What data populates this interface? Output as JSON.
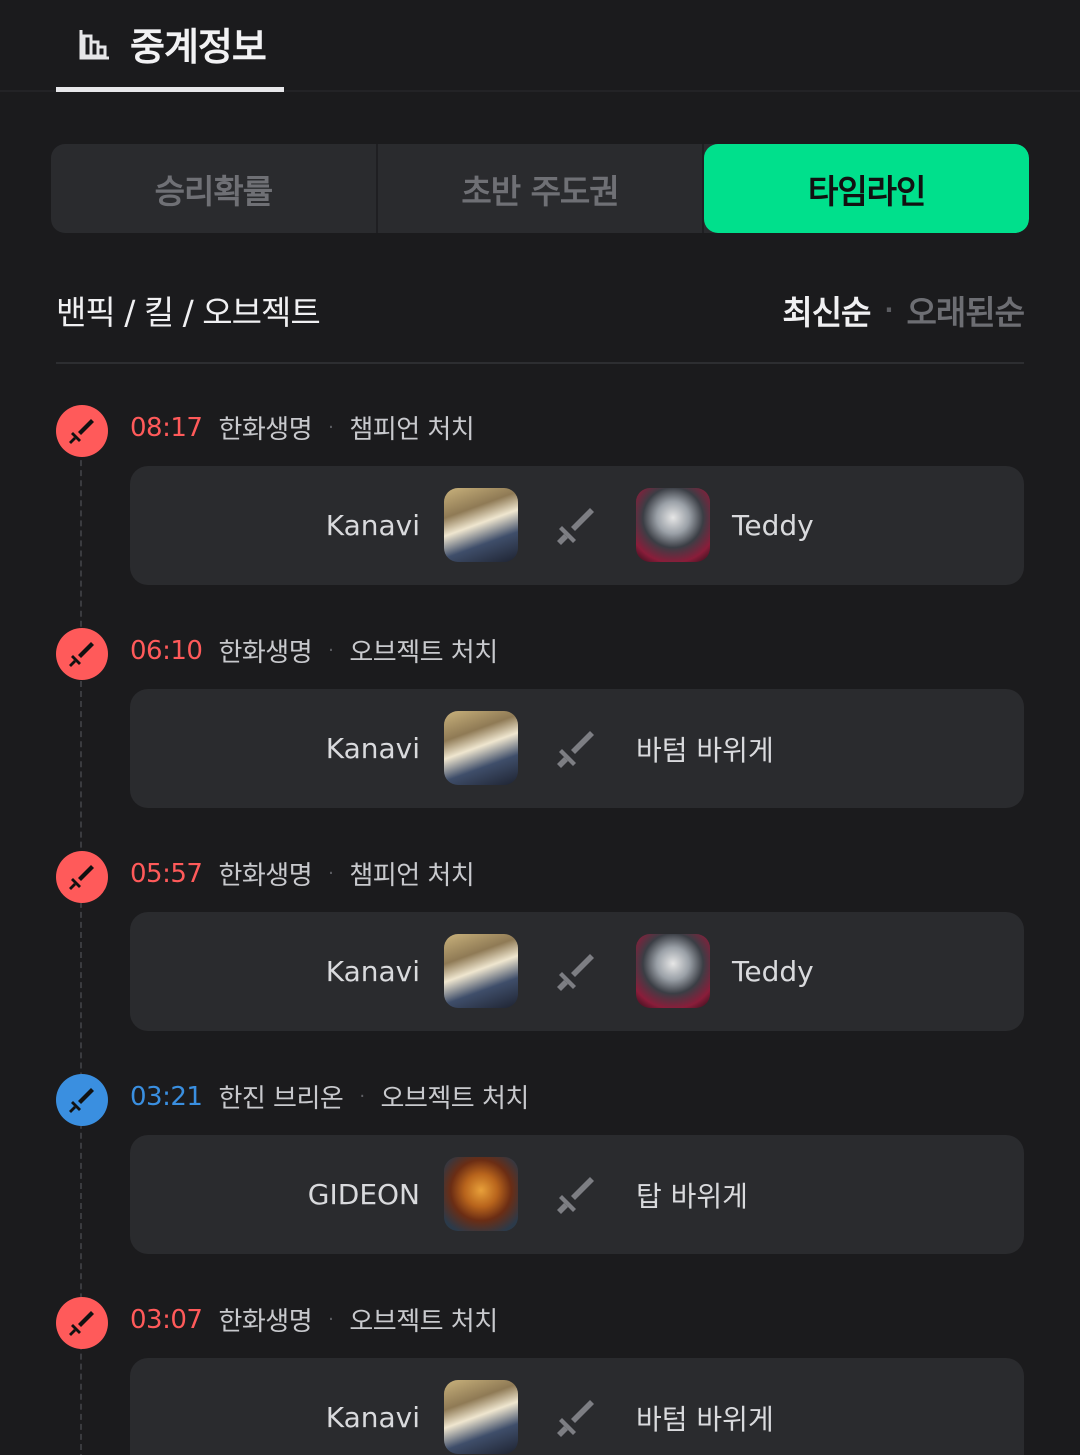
{
  "header": {
    "tab_label": "중계정보",
    "tab_icon": "bar-chart-icon"
  },
  "segments": [
    {
      "label": "승리확률",
      "active": false
    },
    {
      "label": "초반 주도권",
      "active": false
    },
    {
      "label": "타임라인",
      "active": true
    }
  ],
  "section": {
    "title": "밴픽 / 킬 / 오브젝트",
    "sort_newest": "최신순",
    "sort_separator": "·",
    "sort_oldest": "오래된순"
  },
  "colors": {
    "accent": "#00e08c",
    "red_team": "#ff5a5a",
    "blue_team": "#3a8fe0"
  },
  "events": [
    {
      "time": "08:17",
      "team": "한화생명",
      "separator": "·",
      "type": "챔피언 처치",
      "side": "red",
      "killer": "Kanavi",
      "killer_champ": "galio",
      "victim": "Teddy",
      "victim_champ": "jhin",
      "is_objective": false
    },
    {
      "time": "06:10",
      "team": "한화생명",
      "separator": "·",
      "type": "오브젝트 처치",
      "side": "red",
      "killer": "Kanavi",
      "killer_champ": "galio",
      "victim": "바텀 바위게",
      "victim_champ": "",
      "is_objective": true
    },
    {
      "time": "05:57",
      "team": "한화생명",
      "separator": "·",
      "type": "챔피언 처치",
      "side": "red",
      "killer": "Kanavi",
      "killer_champ": "galio",
      "victim": "Teddy",
      "victim_champ": "jhin",
      "is_objective": false
    },
    {
      "time": "03:21",
      "team": "한진 브리온",
      "separator": "·",
      "type": "오브젝트 처치",
      "side": "blue",
      "killer": "GIDEON",
      "killer_champ": "jarvan",
      "victim": "탑 바위게",
      "victim_champ": "",
      "is_objective": true
    },
    {
      "time": "03:07",
      "team": "한화생명",
      "separator": "·",
      "type": "오브젝트 처치",
      "side": "red",
      "killer": "Kanavi",
      "killer_champ": "galio",
      "victim": "바텀 바위게",
      "victim_champ": "",
      "is_objective": true
    }
  ]
}
